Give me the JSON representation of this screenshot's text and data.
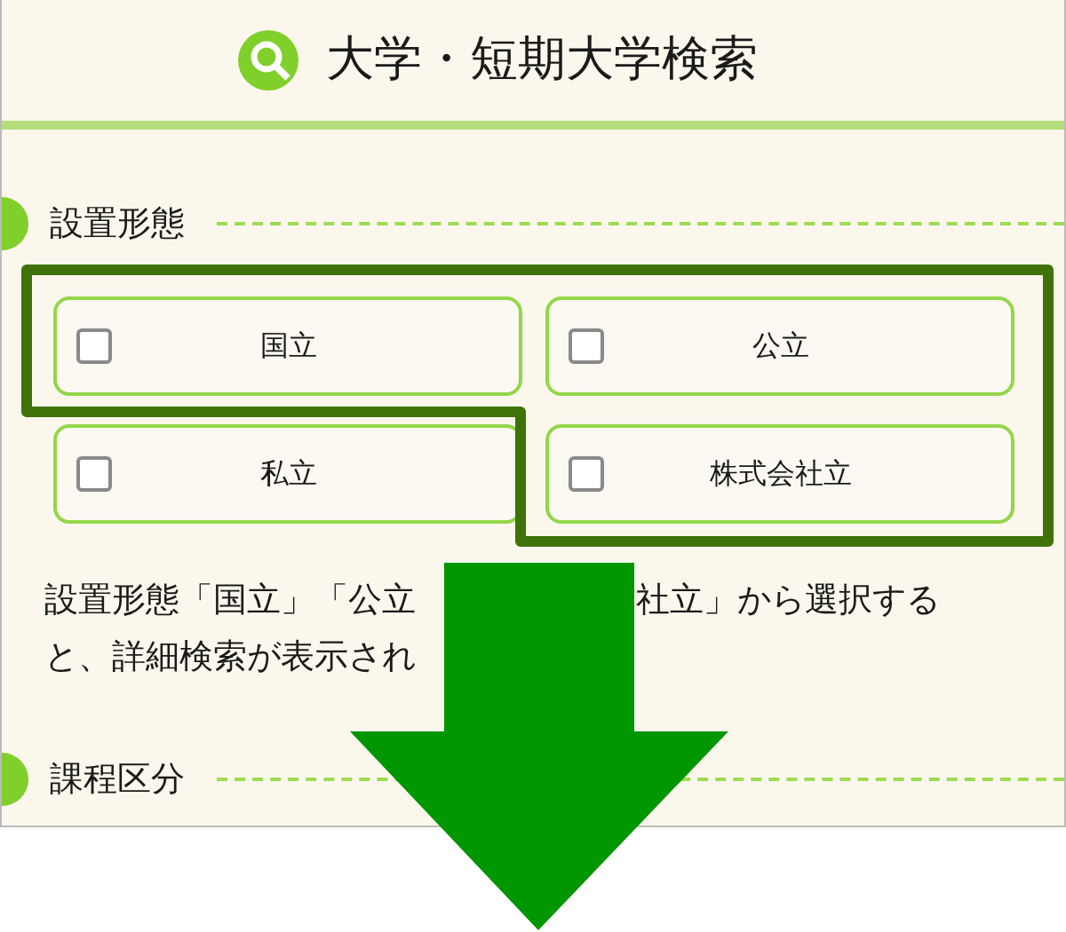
{
  "header": {
    "title": "大学・短期大学検索"
  },
  "sections": [
    {
      "heading": "設置形態",
      "options": [
        {
          "label": "国立",
          "checked": false
        },
        {
          "label": "公立",
          "checked": false
        },
        {
          "label": "私立",
          "checked": false
        },
        {
          "label": "株式会社立",
          "checked": false
        }
      ],
      "note": {
        "line_1_left": "設置形態「国立」「公立",
        "line_1_right": "社立」から選択する",
        "line_2": "と、詳細検索が表示され"
      }
    },
    {
      "heading": "課程区分"
    }
  ]
}
